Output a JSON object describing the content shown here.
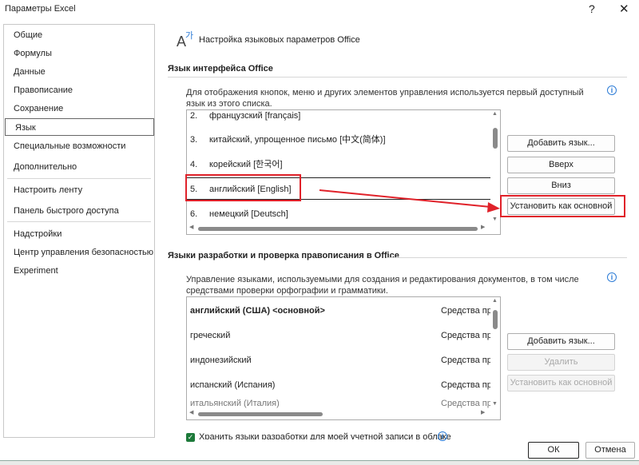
{
  "window": {
    "title": "Параметры Excel",
    "help_glyph": "?",
    "close_glyph": "✕"
  },
  "sidebar": {
    "items": [
      {
        "label": "Общие"
      },
      {
        "label": "Формулы"
      },
      {
        "label": "Данные"
      },
      {
        "label": "Правописание"
      },
      {
        "label": "Сохранение"
      },
      {
        "label": "Язык",
        "selected": true
      },
      {
        "label": "Специальные возможности"
      },
      {
        "label": "Дополнительно"
      },
      {
        "label": "Настроить ленту"
      },
      {
        "label": "Панель быстрого доступа"
      },
      {
        "label": "Надстройки"
      },
      {
        "label": "Центр управления безопасностью"
      },
      {
        "label": "Experiment"
      }
    ]
  },
  "header": {
    "icon": "language-icon",
    "icon_letter_a": "A",
    "icon_letter_k": "가",
    "title": "Настройка языковых параметров Office"
  },
  "ui_language": {
    "section_title": "Язык интерфейса Office",
    "description": "Для отображения кнопок, меню и других элементов управления используется первый доступный язык из этого списка.",
    "items": [
      {
        "num": "2.",
        "label": "французский [français]"
      },
      {
        "num": "3.",
        "label": "китайский, упрощенное письмо [中文(简体)]"
      },
      {
        "num": "4.",
        "label": "корейский [한국어]"
      },
      {
        "num": "5.",
        "label": "английский [English]",
        "selected": true
      },
      {
        "num": "6.",
        "label": "немецкий [Deutsch]"
      }
    ],
    "buttons": {
      "add": "Добавить язык...",
      "up": "Вверх",
      "down": "Вниз",
      "set_primary": "Установить как основной"
    }
  },
  "authoring": {
    "section_title": "Языки разработки и проверка правописания в Office",
    "description": "Управление языками, используемыми для создания и редактирования документов, в том числе средствами проверки орфографии и грамматики.",
    "items": [
      {
        "label": "английский (США) <основной>",
        "status": "Средства пр",
        "bold": true
      },
      {
        "label": "греческий",
        "status": "Средства пр"
      },
      {
        "label": "индонезийский",
        "status": "Средства пр"
      },
      {
        "label": "испанский (Испания)",
        "status": "Средства пр"
      },
      {
        "label": "итальянский (Италия)",
        "status": "Средства пр"
      }
    ],
    "buttons": {
      "add": "Добавить язык...",
      "remove": "Удалить",
      "set_primary": "Установить как основной"
    },
    "cloud_checkbox": {
      "label": "Хранить языки разработки для моей учетной записи в облаке",
      "checked": true
    }
  },
  "footer": {
    "ok": "ОК",
    "cancel": "Отмена"
  },
  "colors": {
    "accent_red": "#e0222a",
    "checkbox_green": "#1d7a3a",
    "info_blue": "#2b7bd6"
  }
}
